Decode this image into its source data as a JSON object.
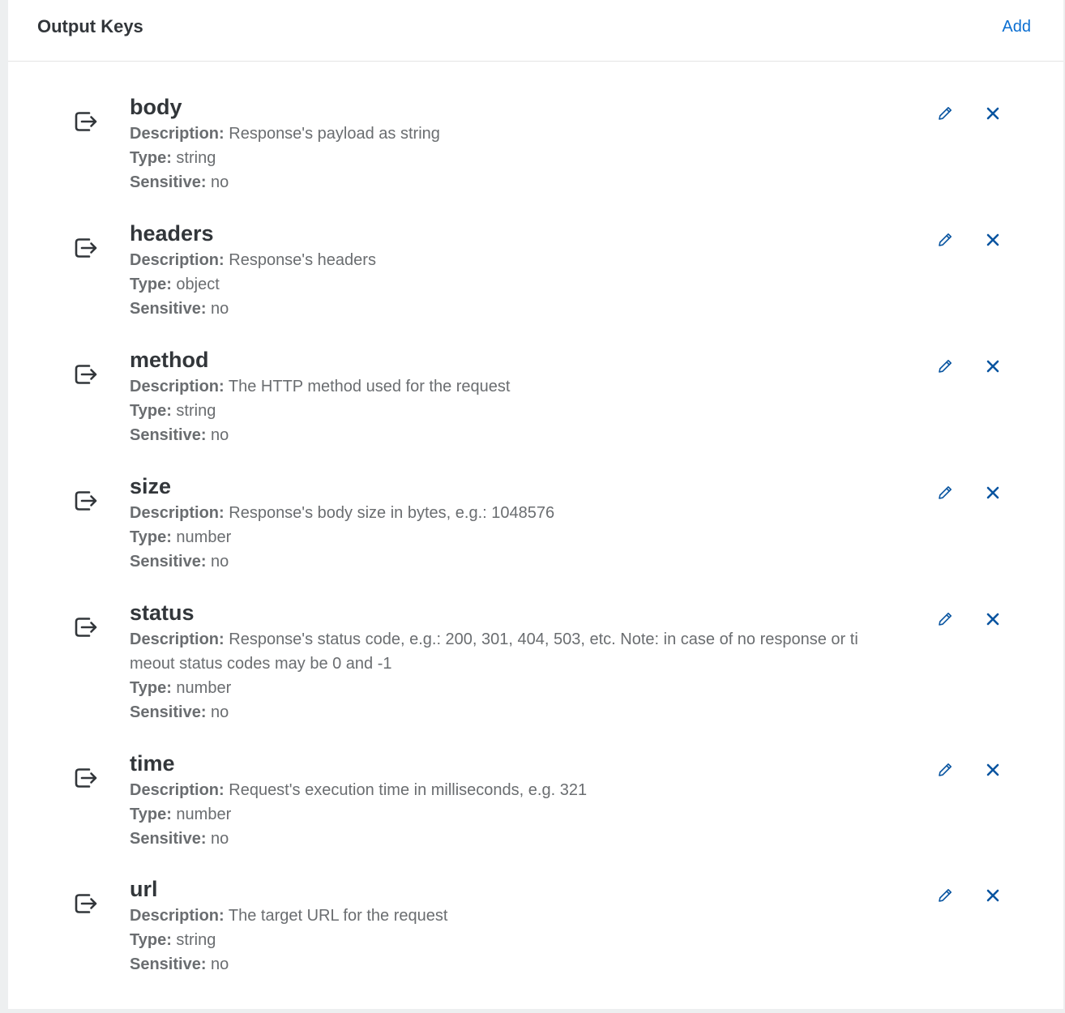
{
  "header": {
    "title": "Output Keys",
    "add_label": "Add"
  },
  "labels": {
    "description": "Description:",
    "type": "Type:",
    "sensitive": "Sensitive:"
  },
  "items": [
    {
      "name": "body",
      "description": "Response's payload as string",
      "type": "string",
      "sensitive": "no"
    },
    {
      "name": "headers",
      "description": "Response's headers",
      "type": "object",
      "sensitive": "no"
    },
    {
      "name": "method",
      "description": "The HTTP method used for the request",
      "type": "string",
      "sensitive": "no"
    },
    {
      "name": "size",
      "description": "Response's body size in bytes, e.g.: 1048576",
      "type": "number",
      "sensitive": "no"
    },
    {
      "name": "status",
      "description": "Response's status code, e.g.: 200, 301, 404, 503, etc. Note: in case of no response or ti",
      "description_cont": "meout status codes may be 0 and -1",
      "type": "number",
      "sensitive": "no"
    },
    {
      "name": "time",
      "description": "Request's execution time in milliseconds, e.g. 321",
      "type": "number",
      "sensitive": "no"
    },
    {
      "name": "url",
      "description": "The target URL for the request",
      "type": "string",
      "sensitive": "no"
    }
  ],
  "icons": {
    "row_icon": "output-arrow-icon",
    "edit_icon": "pencil-icon",
    "delete_icon": "close-icon"
  },
  "colors": {
    "accent": "#0a6ed1",
    "action_icon": "#0854a0",
    "title": "#32363a",
    "text": "#6a6d70"
  }
}
